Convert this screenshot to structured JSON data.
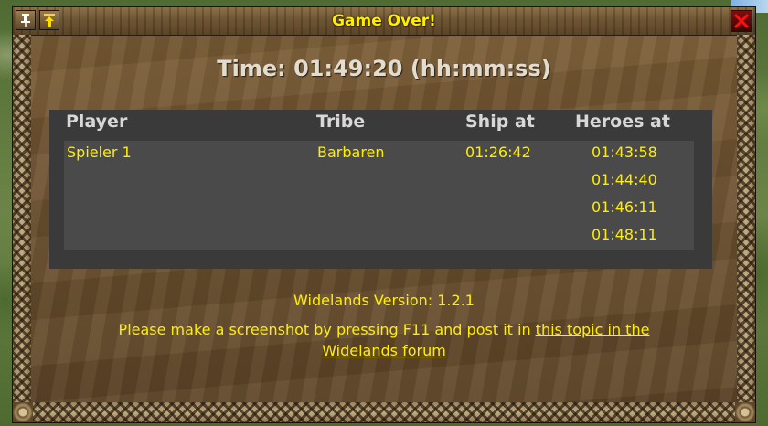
{
  "window": {
    "title": "Game Over!",
    "pin_icon": "pin-icon",
    "minimize_icon": "minimize-icon",
    "close_icon": "close-icon"
  },
  "time_label": "Time: 01:49:20 (hh:mm:ss)",
  "table": {
    "columns": [
      "Player",
      "Tribe",
      "Ship at",
      "Heroes at"
    ],
    "rows": [
      {
        "player": "Spieler 1",
        "tribe": "Barbaren",
        "ship_at": "01:26:42",
        "heroes_at": [
          "01:43:58",
          "01:44:40",
          "01:46:11",
          "01:48:11"
        ]
      }
    ]
  },
  "version_text": "Widelands Version: 1.2.1",
  "message": {
    "text": "Please make a screenshot by pressing F11 and post it in ",
    "link_line1": "this topic in the",
    "link_line2": "Widelands forum"
  },
  "colors": {
    "accent_yellow": "#ffee00",
    "header_text": "#d8d8d8",
    "close_red": "#e00000"
  }
}
